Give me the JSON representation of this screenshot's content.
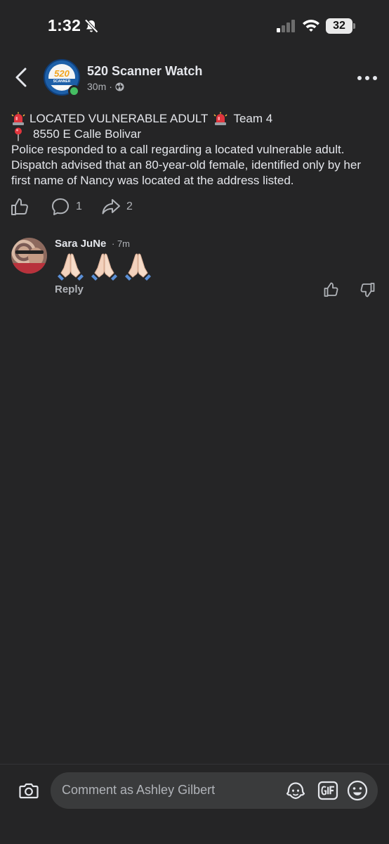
{
  "status_bar": {
    "time": "1:32",
    "battery": "32"
  },
  "header": {
    "page_name": "520 Scanner Watch",
    "post_time": "30m",
    "meta_separator": "·",
    "logo_number": "520",
    "logo_band": "SCANNER WATCH"
  },
  "post": {
    "line1_text": "LOCATED VULNERABLE ADULT",
    "line1_suffix": "Team 4",
    "line2_text": "8550 E Calle Bolivar",
    "body": "Police responded to a call regarding a located vulnerable adult. Dispatch advised that an 80-year-old female, identified only by her first name of Nancy  was located at the address listed."
  },
  "actions": {
    "comment_count": "1",
    "share_count": "2"
  },
  "comment": {
    "author": "Sara JuNe",
    "time": "· 7m",
    "reply_label": "Reply"
  },
  "composer": {
    "placeholder": "Comment as Ashley Gilbert"
  },
  "colors": {
    "background": "#252526",
    "text": "#e4e6eb",
    "muted": "#b0b3b8",
    "online": "#45bd62",
    "input_bg": "#3a3b3c"
  }
}
